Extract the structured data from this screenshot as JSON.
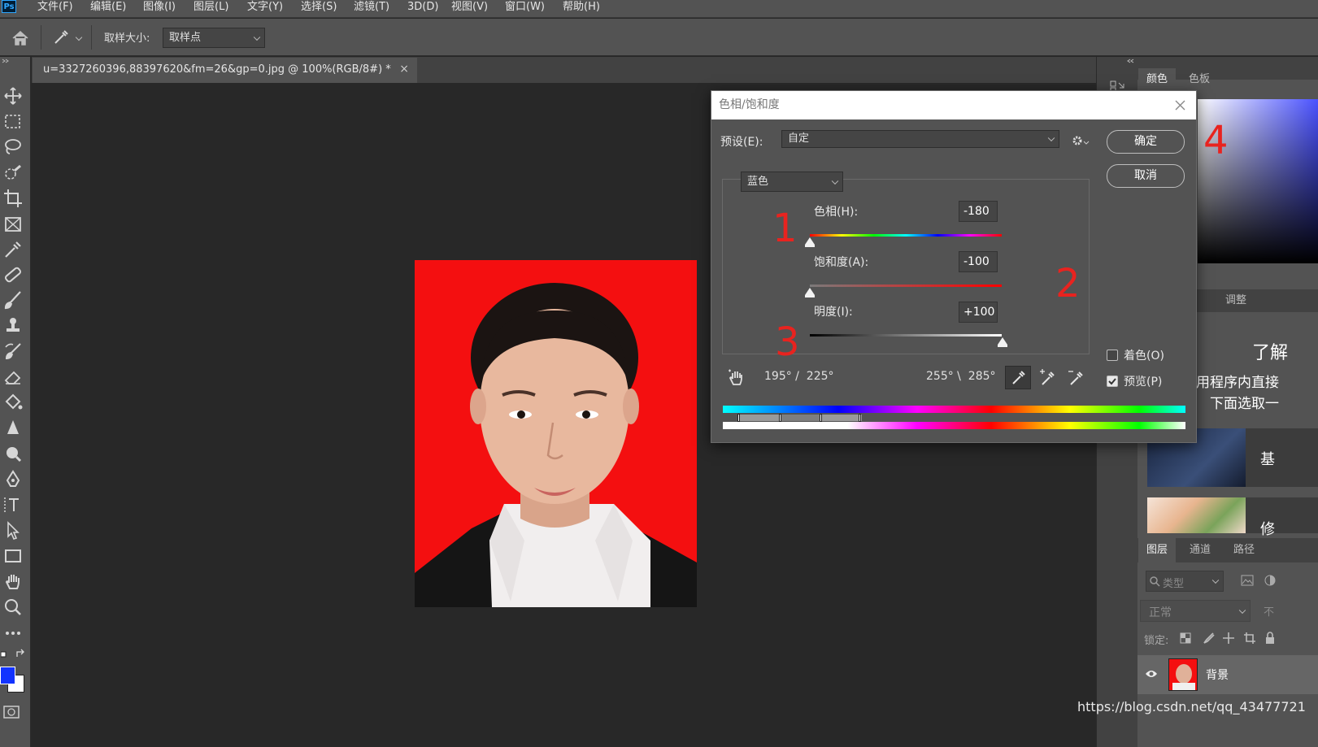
{
  "app": {
    "logo": "Ps"
  },
  "menu": [
    "文件(F)",
    "编辑(E)",
    "图像(I)",
    "图层(L)",
    "文字(Y)",
    "选择(S)",
    "滤镜(T)",
    "3D(D)",
    "视图(V)",
    "窗口(W)",
    "帮助(H)"
  ],
  "options_bar": {
    "sample_size_label": "取样大小:",
    "sample_size_value": "取样点"
  },
  "document": {
    "tab_title": "u=3327260396,88397620&fm=26&gp=0.jpg @ 100%(RGB/8#) *",
    "close": "×"
  },
  "panels": {
    "color_tabs": [
      "颜色",
      "色板"
    ],
    "adjust_tab": "调整",
    "learn_title": "了解",
    "learn_text1": "用程序内直接",
    "learn_text2": "下面选取一",
    "learn_items": [
      "基",
      "修"
    ],
    "layer_tabs": [
      "图层",
      "通道",
      "路径"
    ],
    "search_placeholder": "类型",
    "blend_mode": "正常",
    "opacity_label": "不",
    "lock_label": "锁定:",
    "layer_name": "背景"
  },
  "dialog": {
    "title": "色相/饱和度",
    "preset_label": "预设(E):",
    "preset_value": "自定",
    "channel": "蓝色",
    "hue_label": "色相(H):",
    "hue_value": "-180",
    "sat_label": "饱和度(A):",
    "sat_value": "-100",
    "light_label": "明度(I):",
    "light_value": "+100",
    "ok": "确定",
    "cancel": "取消",
    "colorize": "着色(O)",
    "preview": "预览(P)",
    "range_left": "195° /  225°",
    "range_right": "255° \\  285°",
    "colorize_checked": false,
    "preview_checked": true
  },
  "annotations": [
    "1",
    "2",
    "3",
    "4"
  ],
  "colors": {
    "photo_bg": "#f40f10",
    "foreground": "#1233ff",
    "background": "#ffffff"
  },
  "watermark": "https://blog.csdn.net/qq_43477721"
}
